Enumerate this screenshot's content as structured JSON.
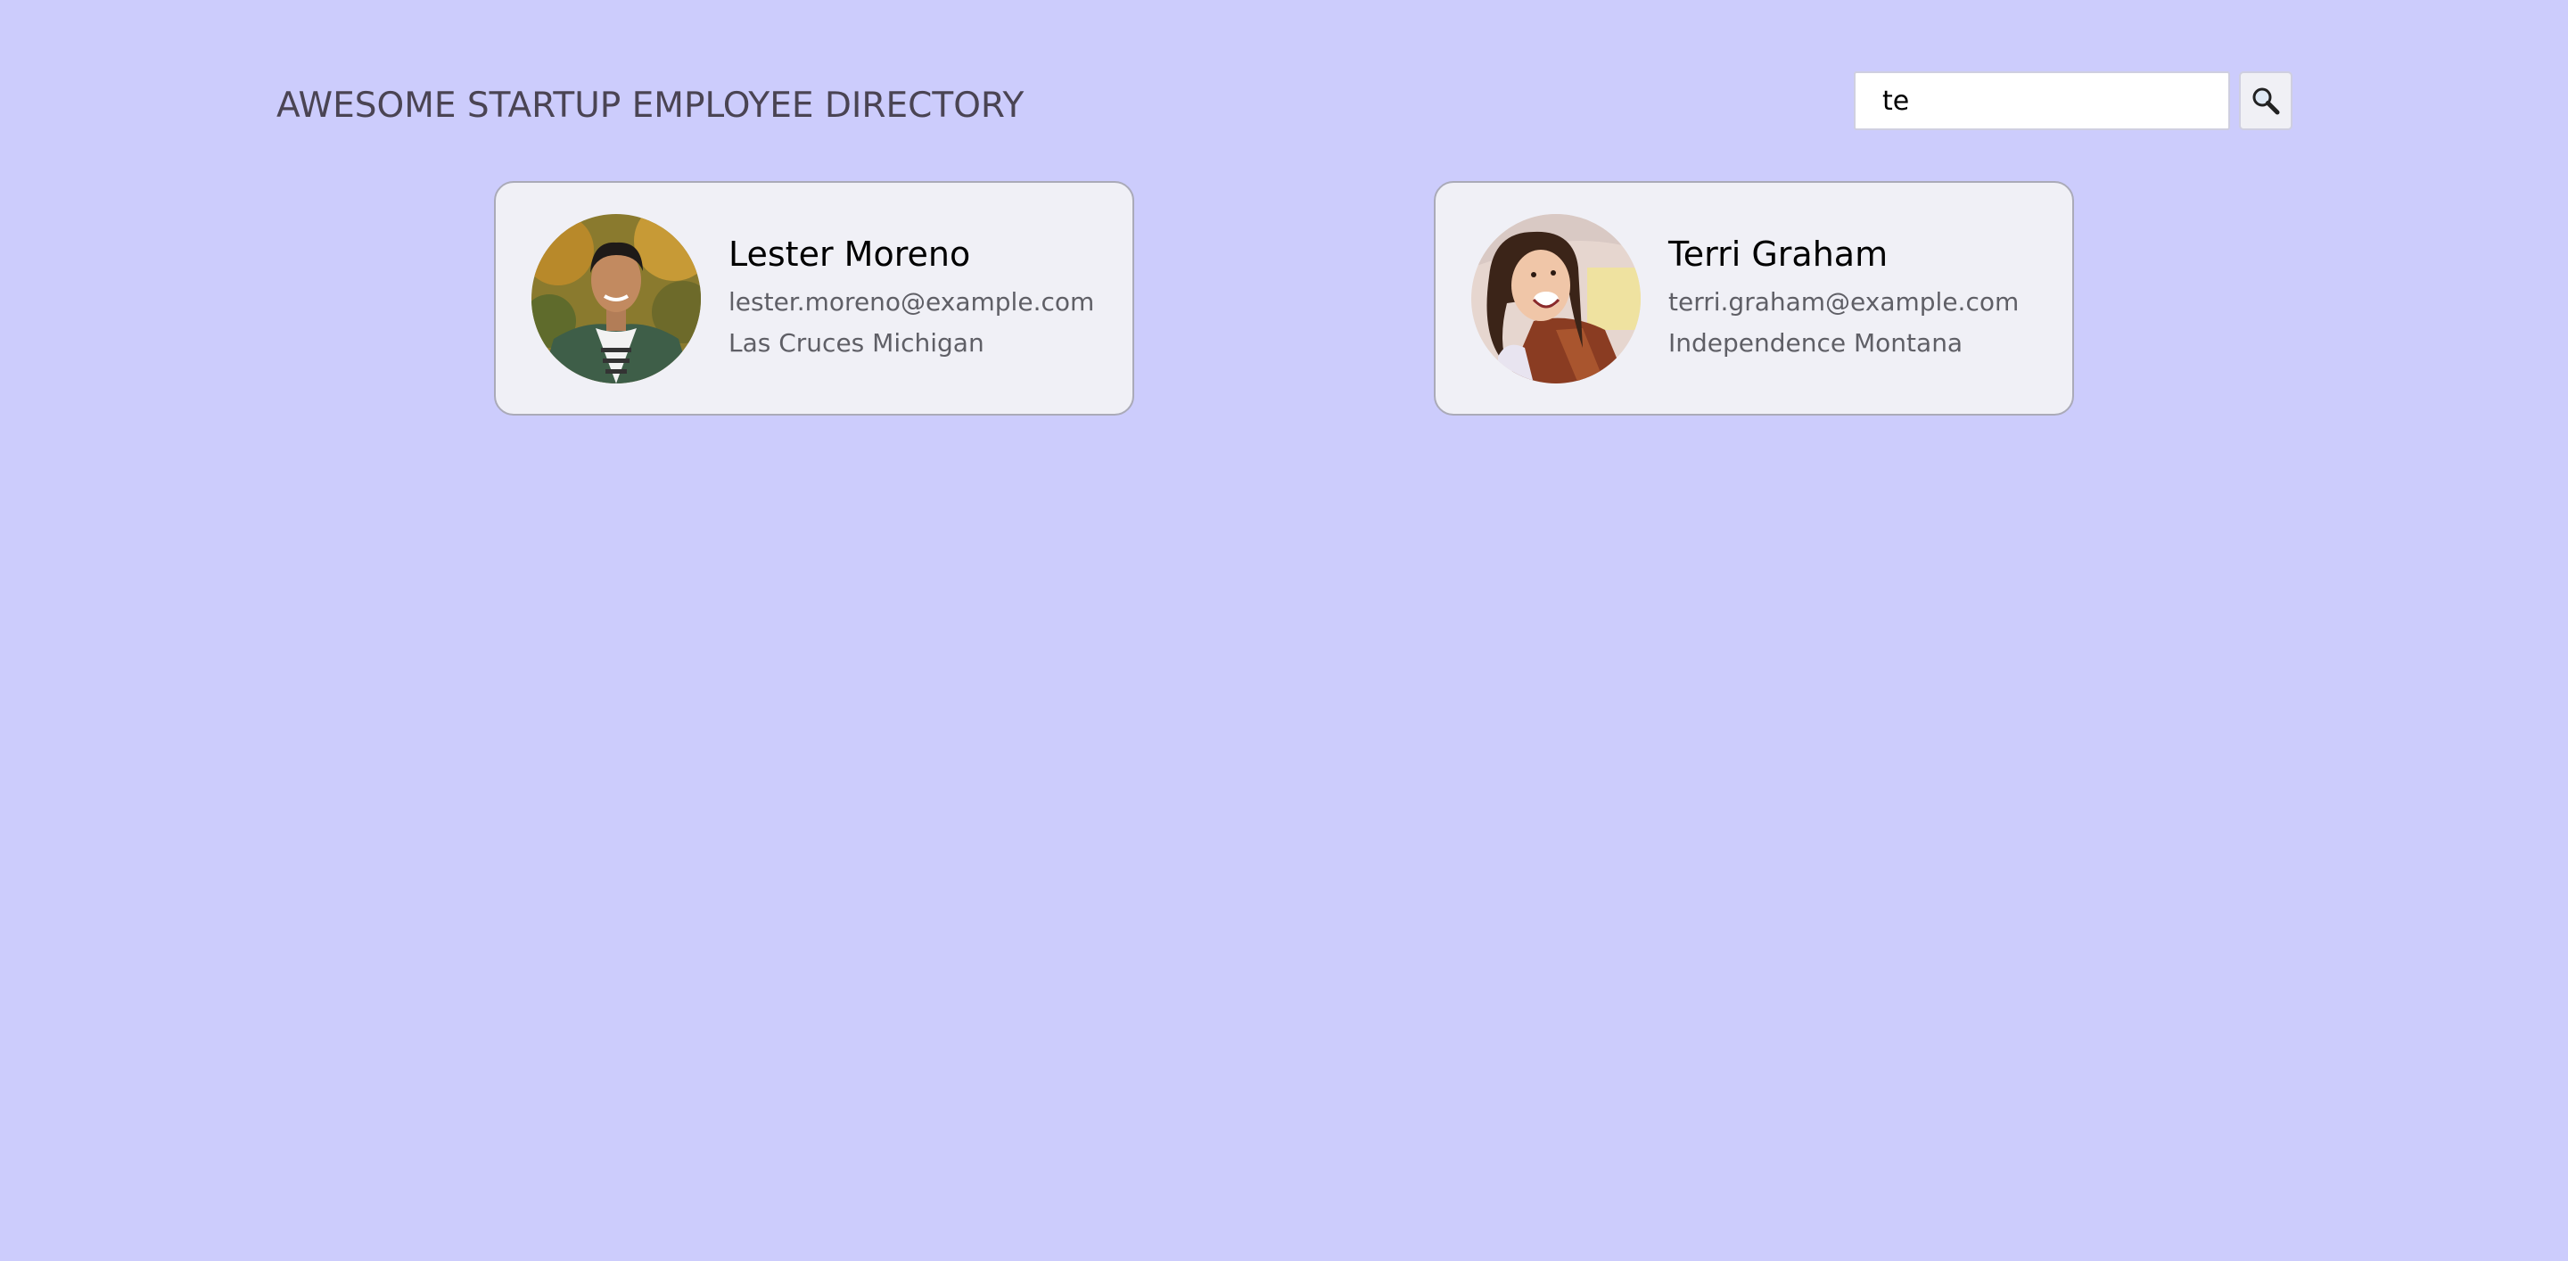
{
  "header": {
    "title": "AWESOME STARTUP EMPLOYEE DIRECTORY"
  },
  "search": {
    "value": "te",
    "button_icon": "search-icon"
  },
  "employees": [
    {
      "name": "Lester Moreno",
      "email": "lester.moreno@example.com",
      "location": "Las Cruces Michigan"
    },
    {
      "name": "Terri Graham",
      "email": "terri.graham@example.com",
      "location": "Independence Montana"
    }
  ],
  "colors": {
    "background": "#ccccfc",
    "card": "#f0f0f6",
    "title": "#4a4453"
  }
}
